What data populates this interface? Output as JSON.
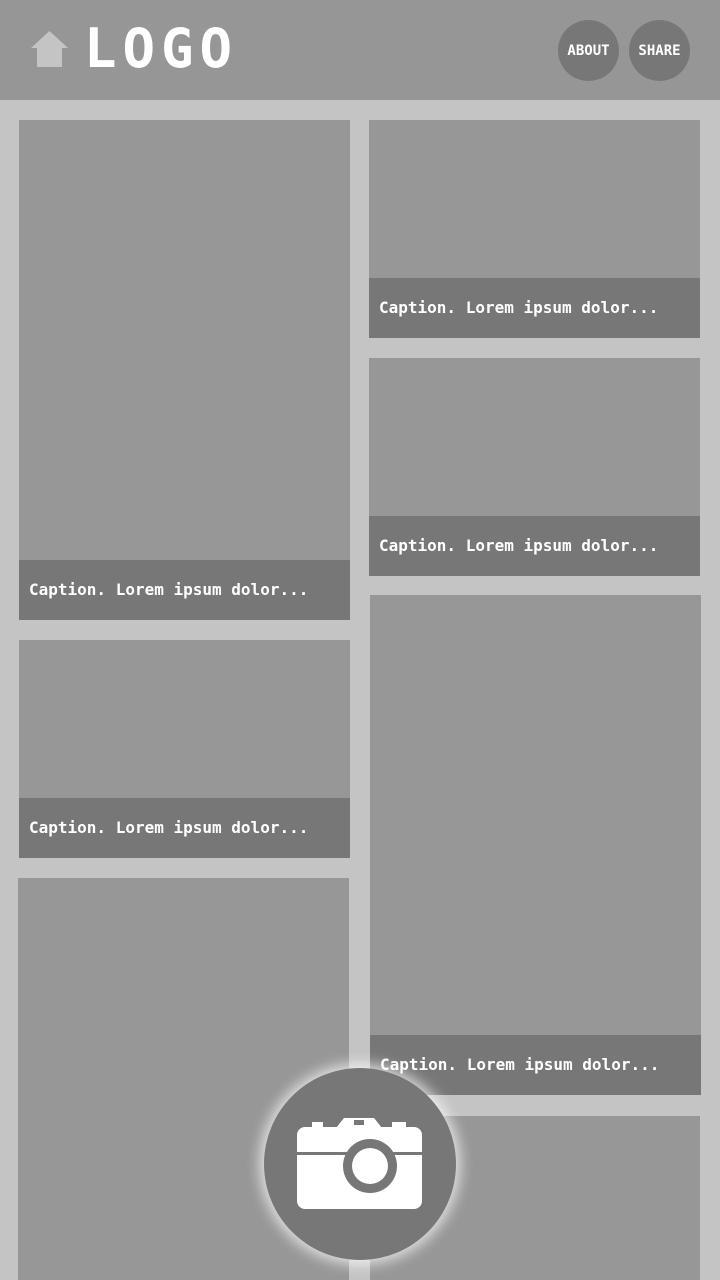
{
  "header": {
    "home_icon": "home-icon",
    "logo_text": "LOGO",
    "about_label": "ABOUT",
    "share_label": "SHARE"
  },
  "cards": [
    {
      "caption": "Caption. Lorem ipsum dolor..."
    },
    {
      "caption": "Caption. Lorem ipsum dolor..."
    },
    {
      "caption": "Caption. Lorem ipsum dolor..."
    },
    {
      "caption": "Caption. Lorem ipsum dolor..."
    },
    {
      "caption": "Caption. Lorem ipsum dolor..."
    },
    {
      "caption": ""
    },
    {
      "caption": ""
    }
  ],
  "fab": {
    "icon": "camera-icon"
  },
  "colors": {
    "background": "#c4c4c4",
    "header": "#969696",
    "card": "#979797",
    "caption_bar": "#777777",
    "text": "#ffffff"
  }
}
